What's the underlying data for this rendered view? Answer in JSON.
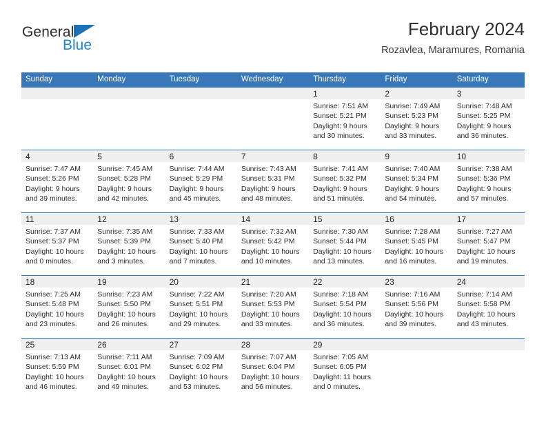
{
  "logo": {
    "line1": "General",
    "line2": "Blue",
    "triangle_color": "#1b72b8",
    "blue_color": "#1b86d6"
  },
  "header": {
    "title": "February 2024",
    "subtitle": "Rozavlea, Maramures, Romania"
  },
  "theme": {
    "header_blue": "#3878b8",
    "daynum_band": "#efefef",
    "text": "#2c2c2c"
  },
  "weekday_headers": [
    "Sunday",
    "Monday",
    "Tuesday",
    "Wednesday",
    "Thursday",
    "Friday",
    "Saturday"
  ],
  "labels": {
    "sunrise_prefix": "Sunrise:",
    "sunset_prefix": "Sunset:",
    "daylight_prefix": "Daylight:"
  },
  "weeks": [
    [
      {
        "day": "",
        "empty": true
      },
      {
        "day": "",
        "empty": true
      },
      {
        "day": "",
        "empty": true
      },
      {
        "day": "",
        "empty": true
      },
      {
        "day": "1",
        "sunrise": "Sunrise: 7:51 AM",
        "sunset": "Sunset: 5:21 PM",
        "daylight_1": "Daylight: 9 hours",
        "daylight_2": "and 30 minutes."
      },
      {
        "day": "2",
        "sunrise": "Sunrise: 7:49 AM",
        "sunset": "Sunset: 5:23 PM",
        "daylight_1": "Daylight: 9 hours",
        "daylight_2": "and 33 minutes."
      },
      {
        "day": "3",
        "sunrise": "Sunrise: 7:48 AM",
        "sunset": "Sunset: 5:25 PM",
        "daylight_1": "Daylight: 9 hours",
        "daylight_2": "and 36 minutes."
      }
    ],
    [
      {
        "day": "4",
        "sunrise": "Sunrise: 7:47 AM",
        "sunset": "Sunset: 5:26 PM",
        "daylight_1": "Daylight: 9 hours",
        "daylight_2": "and 39 minutes."
      },
      {
        "day": "5",
        "sunrise": "Sunrise: 7:45 AM",
        "sunset": "Sunset: 5:28 PM",
        "daylight_1": "Daylight: 9 hours",
        "daylight_2": "and 42 minutes."
      },
      {
        "day": "6",
        "sunrise": "Sunrise: 7:44 AM",
        "sunset": "Sunset: 5:29 PM",
        "daylight_1": "Daylight: 9 hours",
        "daylight_2": "and 45 minutes."
      },
      {
        "day": "7",
        "sunrise": "Sunrise: 7:43 AM",
        "sunset": "Sunset: 5:31 PM",
        "daylight_1": "Daylight: 9 hours",
        "daylight_2": "and 48 minutes."
      },
      {
        "day": "8",
        "sunrise": "Sunrise: 7:41 AM",
        "sunset": "Sunset: 5:32 PM",
        "daylight_1": "Daylight: 9 hours",
        "daylight_2": "and 51 minutes."
      },
      {
        "day": "9",
        "sunrise": "Sunrise: 7:40 AM",
        "sunset": "Sunset: 5:34 PM",
        "daylight_1": "Daylight: 9 hours",
        "daylight_2": "and 54 minutes."
      },
      {
        "day": "10",
        "sunrise": "Sunrise: 7:38 AM",
        "sunset": "Sunset: 5:36 PM",
        "daylight_1": "Daylight: 9 hours",
        "daylight_2": "and 57 minutes."
      }
    ],
    [
      {
        "day": "11",
        "sunrise": "Sunrise: 7:37 AM",
        "sunset": "Sunset: 5:37 PM",
        "daylight_1": "Daylight: 10 hours",
        "daylight_2": "and 0 minutes."
      },
      {
        "day": "12",
        "sunrise": "Sunrise: 7:35 AM",
        "sunset": "Sunset: 5:39 PM",
        "daylight_1": "Daylight: 10 hours",
        "daylight_2": "and 3 minutes."
      },
      {
        "day": "13",
        "sunrise": "Sunrise: 7:33 AM",
        "sunset": "Sunset: 5:40 PM",
        "daylight_1": "Daylight: 10 hours",
        "daylight_2": "and 7 minutes."
      },
      {
        "day": "14",
        "sunrise": "Sunrise: 7:32 AM",
        "sunset": "Sunset: 5:42 PM",
        "daylight_1": "Daylight: 10 hours",
        "daylight_2": "and 10 minutes."
      },
      {
        "day": "15",
        "sunrise": "Sunrise: 7:30 AM",
        "sunset": "Sunset: 5:44 PM",
        "daylight_1": "Daylight: 10 hours",
        "daylight_2": "and 13 minutes."
      },
      {
        "day": "16",
        "sunrise": "Sunrise: 7:28 AM",
        "sunset": "Sunset: 5:45 PM",
        "daylight_1": "Daylight: 10 hours",
        "daylight_2": "and 16 minutes."
      },
      {
        "day": "17",
        "sunrise": "Sunrise: 7:27 AM",
        "sunset": "Sunset: 5:47 PM",
        "daylight_1": "Daylight: 10 hours",
        "daylight_2": "and 19 minutes."
      }
    ],
    [
      {
        "day": "18",
        "sunrise": "Sunrise: 7:25 AM",
        "sunset": "Sunset: 5:48 PM",
        "daylight_1": "Daylight: 10 hours",
        "daylight_2": "and 23 minutes."
      },
      {
        "day": "19",
        "sunrise": "Sunrise: 7:23 AM",
        "sunset": "Sunset: 5:50 PM",
        "daylight_1": "Daylight: 10 hours",
        "daylight_2": "and 26 minutes."
      },
      {
        "day": "20",
        "sunrise": "Sunrise: 7:22 AM",
        "sunset": "Sunset: 5:51 PM",
        "daylight_1": "Daylight: 10 hours",
        "daylight_2": "and 29 minutes."
      },
      {
        "day": "21",
        "sunrise": "Sunrise: 7:20 AM",
        "sunset": "Sunset: 5:53 PM",
        "daylight_1": "Daylight: 10 hours",
        "daylight_2": "and 33 minutes."
      },
      {
        "day": "22",
        "sunrise": "Sunrise: 7:18 AM",
        "sunset": "Sunset: 5:54 PM",
        "daylight_1": "Daylight: 10 hours",
        "daylight_2": "and 36 minutes."
      },
      {
        "day": "23",
        "sunrise": "Sunrise: 7:16 AM",
        "sunset": "Sunset: 5:56 PM",
        "daylight_1": "Daylight: 10 hours",
        "daylight_2": "and 39 minutes."
      },
      {
        "day": "24",
        "sunrise": "Sunrise: 7:14 AM",
        "sunset": "Sunset: 5:58 PM",
        "daylight_1": "Daylight: 10 hours",
        "daylight_2": "and 43 minutes."
      }
    ],
    [
      {
        "day": "25",
        "sunrise": "Sunrise: 7:13 AM",
        "sunset": "Sunset: 5:59 PM",
        "daylight_1": "Daylight: 10 hours",
        "daylight_2": "and 46 minutes."
      },
      {
        "day": "26",
        "sunrise": "Sunrise: 7:11 AM",
        "sunset": "Sunset: 6:01 PM",
        "daylight_1": "Daylight: 10 hours",
        "daylight_2": "and 49 minutes."
      },
      {
        "day": "27",
        "sunrise": "Sunrise: 7:09 AM",
        "sunset": "Sunset: 6:02 PM",
        "daylight_1": "Daylight: 10 hours",
        "daylight_2": "and 53 minutes."
      },
      {
        "day": "28",
        "sunrise": "Sunrise: 7:07 AM",
        "sunset": "Sunset: 6:04 PM",
        "daylight_1": "Daylight: 10 hours",
        "daylight_2": "and 56 minutes."
      },
      {
        "day": "29",
        "sunrise": "Sunrise: 7:05 AM",
        "sunset": "Sunset: 6:05 PM",
        "daylight_1": "Daylight: 11 hours",
        "daylight_2": "and 0 minutes."
      },
      {
        "day": "",
        "empty": true
      },
      {
        "day": "",
        "empty": true
      }
    ]
  ]
}
